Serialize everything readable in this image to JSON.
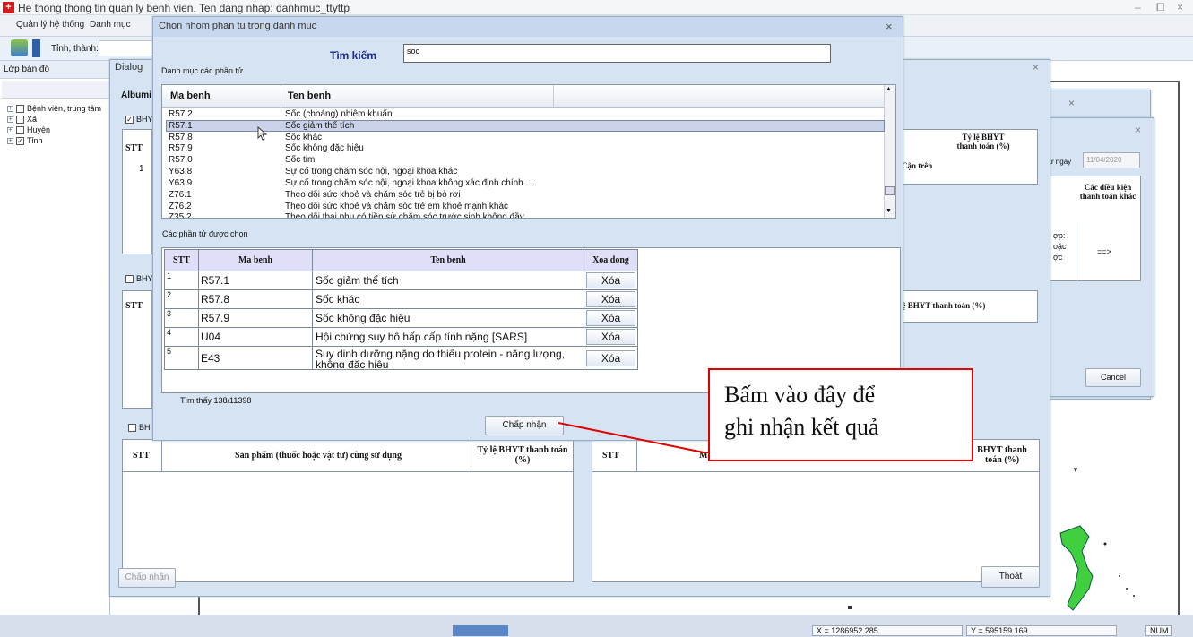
{
  "app": {
    "title": "He thong thong tin quan ly benh vien. Ten dang nhap: danhmuc_ttyttp",
    "window_controls": [
      "–",
      "⧠",
      "×"
    ]
  },
  "menu": [
    "Quản lý hệ thống",
    "Danh mục"
  ],
  "toolbar": {
    "province_label": "Tỉnh, thành:"
  },
  "left_panel": {
    "title": "Lớp bản đồ",
    "items": [
      {
        "label": "Bệnh viện, trung tâm",
        "checked": false
      },
      {
        "label": "Xã",
        "checked": false
      },
      {
        "label": "Huyện",
        "checked": false
      },
      {
        "label": "Tỉnh",
        "checked": true
      }
    ]
  },
  "status": {
    "x": "X = 1286952.285",
    "y": "Y = 595159.169",
    "num": "NUM"
  },
  "dialog_back": {
    "title": "Dialog",
    "albumin": "Albumi",
    "bhyt1": "BHY",
    "stt": "STT",
    "one": "1",
    "bhyt2": "BHY",
    "bh3": "BH",
    "can_tren": "Cận trên",
    "ty_le": "Tỷ lệ BHYT thanh toán (%)",
    "ty_le2": "lệ BHYT thanh toán (%)",
    "bottom_left": {
      "stt": "STT",
      "sp": "Sản phẩm (thuốc hoặc vật tư) cùng sử dụng",
      "tyle": "Tỷ lệ BHYT thanh toán (%)"
    },
    "bottom_right": {
      "stt": "STT",
      "ma": "Mã",
      "tyle": "BHYT thanh toán (%)"
    },
    "chap_nhan": "Chấp nhận",
    "thoat": "Thoát"
  },
  "dialog_right": {
    "from_date_label": "từ ngày",
    "from_date": "11/04/2020",
    "cac_dieu": "Các điều kiện thanh toán khác",
    "hop": "ợp:",
    "oac": "oặc",
    "oc": "ợc",
    "arrow": "==>",
    "cancel": "Cancel"
  },
  "main_dialog": {
    "title": "Chon nhom phan tu trong danh muc",
    "search_label": "Tìm kiếm",
    "search_value": "soc",
    "list_label": "Danh mục các phần tử",
    "list_headers": [
      "Ma benh",
      "Ten benh"
    ],
    "list_rows": [
      [
        "R57.2",
        "Sốc (choáng) nhiễm khuẩn"
      ],
      [
        "R57.1",
        "Sốc giảm thể tích"
      ],
      [
        "R57.8",
        "Sốc khác"
      ],
      [
        "R57.9",
        "Sốc không đặc hiệu"
      ],
      [
        "R57.0",
        "Sốc tim"
      ],
      [
        "Y63.8",
        "Sự cố trong chăm sóc nội, ngoại khoa khác"
      ],
      [
        "Y63.9",
        "Sự cố trong chăm sóc nội, ngoại khoa không xác định chính ..."
      ],
      [
        "Z76.1",
        "Theo dõi sức khoẻ và chăm sóc trẻ bị bỏ rơi"
      ],
      [
        "Z76.2",
        "Theo dõi sức khoẻ và chăm sóc trẻ em khoẻ mạnh khác"
      ],
      [
        "Z35.2",
        "Theo dõi thai phụ có tiền sử chăm sóc trước sinh không đầy"
      ]
    ],
    "selected_label": "Các phần tử được chọn",
    "selected_headers": [
      "STT",
      "Ma benh",
      "Ten benh",
      "Xoa dong"
    ],
    "selected_rows": [
      [
        "1",
        "R57.1",
        "Sốc giảm thể tích",
        "Xóa"
      ],
      [
        "2",
        "R57.8",
        "Sốc khác",
        "Xóa"
      ],
      [
        "3",
        "R57.9",
        "Sốc không đặc hiệu",
        "Xóa"
      ],
      [
        "4",
        "U04",
        "Hội chứng suy hô hấp cấp tính nặng [SARS]",
        "Xóa"
      ],
      [
        "5",
        "E43",
        "Suy dinh dưỡng nặng do thiếu protein - năng lượng, không đặc hiệu",
        "Xóa"
      ]
    ],
    "found": "Tìm thấy  138/11398",
    "accept": "Chấp nhận",
    "close": "×"
  },
  "callout": {
    "line1": "Bấm vào đây để",
    "line2": "ghi nhận kết quả"
  }
}
